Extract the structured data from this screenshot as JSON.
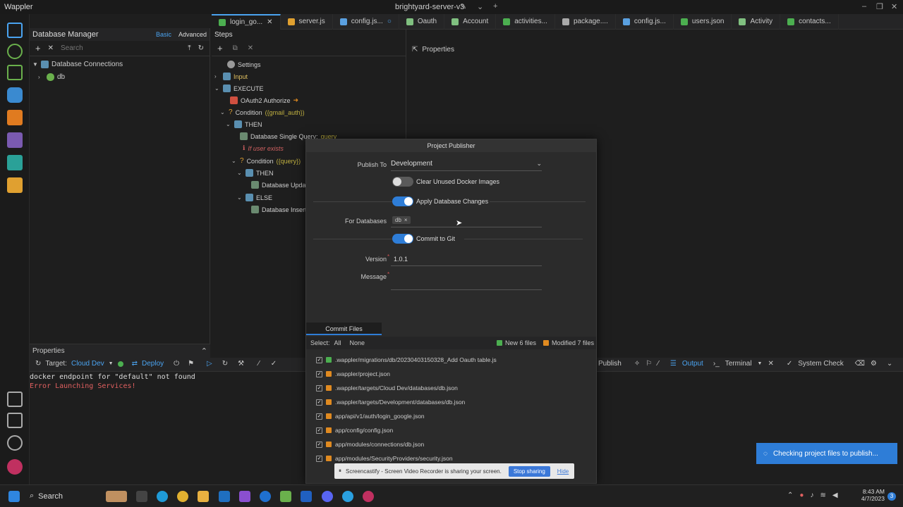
{
  "titlebar": {
    "app": "Wappler",
    "project": "brightyard-server-v3"
  },
  "tabs": [
    {
      "label": "login_go...",
      "color": "#4caf50"
    },
    {
      "label": "server.js",
      "color": "#e0a030"
    },
    {
      "label": "config.js...",
      "color": "#5aa0e0"
    },
    {
      "label": "Oauth",
      "color": "#80c080"
    },
    {
      "label": "Account",
      "color": "#80c080"
    },
    {
      "label": "activities...",
      "color": "#4caf50"
    },
    {
      "label": "package....",
      "color": "#aaaaaa"
    },
    {
      "label": "config.js...",
      "color": "#5aa0e0"
    },
    {
      "label": "users.json",
      "color": "#4caf50"
    },
    {
      "label": "Activity",
      "color": "#80c080"
    },
    {
      "label": "contacts...",
      "color": "#4caf50"
    }
  ],
  "db_manager": {
    "title": "Database Manager",
    "basic": "Basic",
    "advanced": "Advanced",
    "search_placeholder": "Search",
    "tree": {
      "root": "Database Connections",
      "child": "db"
    }
  },
  "steps": {
    "title": "Steps",
    "items": [
      {
        "label": "Settings"
      },
      {
        "label": "Input"
      },
      {
        "label": "EXECUTE"
      },
      {
        "label": "OAuth2 Authorize"
      },
      {
        "label": "Condition",
        "extra": "({gmail_auth})"
      },
      {
        "label": "THEN"
      },
      {
        "label": "Database Single Query:",
        "extra": "query"
      },
      {
        "label": "If user exists"
      },
      {
        "label": "Condition",
        "extra": "({query})"
      },
      {
        "label": "THEN"
      },
      {
        "label": "Database Updat"
      },
      {
        "label": "ELSE"
      },
      {
        "label": "Database Insert"
      }
    ]
  },
  "properties": {
    "title": "Properties"
  },
  "bottom": {
    "properties": "Properties",
    "target_label": "Target:",
    "target_value": "Cloud Dev",
    "deploy": "Deploy",
    "publish": "Publish",
    "output": "Output",
    "terminal": "Terminal",
    "system_check": "System Check",
    "console": [
      "docker endpoint for \"default\" not found",
      "Error Launching Services!"
    ]
  },
  "publisher": {
    "title": "Project Publisher",
    "publish_to_label": "Publish To",
    "publish_to_value": "Development",
    "clear_docker": "Clear Unused Docker Images",
    "apply_db": "Apply Database Changes",
    "for_db_label": "For Databases",
    "db_chip": "db",
    "commit_git": "Commit to Git",
    "version_label": "Version",
    "version_value": "1.0.1",
    "message_label": "Message",
    "commit_tab": "Commit Files",
    "select_label": "Select:",
    "select_all": "All",
    "select_none": "None",
    "new_files": "New 6 files",
    "modified_files": "Modified 7 files",
    "files": [
      {
        "name": ".wappler/migrations/db/20230403150328_Add Oauth table.js",
        "status": "new"
      },
      {
        "name": ".wappler/project.json",
        "status": "mod"
      },
      {
        "name": ".wappler/targets/Cloud Dev/databases/db.json",
        "status": "mod"
      },
      {
        "name": ".wappler/targets/Development/databases/db.json",
        "status": "mod"
      },
      {
        "name": "app/api/v1/auth/login_google.json",
        "status": "mod"
      },
      {
        "name": "app/config/config.json",
        "status": "mod"
      },
      {
        "name": "app/modules/connections/db.json",
        "status": "mod"
      },
      {
        "name": "app/modules/SecurityProviders/security.json",
        "status": "mod"
      }
    ]
  },
  "screen_share": {
    "text": "Screencastify - Screen Video Recorder is sharing your screen.",
    "stop": "Stop sharing",
    "hide": "Hide"
  },
  "toast": {
    "text": "Checking project files to publish..."
  },
  "taskbar": {
    "search": "Search",
    "time": "8:43 AM",
    "date": "4/7/2023",
    "badge": "3"
  },
  "colors": {
    "accent": "#2e7dd7",
    "new": "#4caf50",
    "modified": "#e08a20",
    "error": "#e06060"
  }
}
